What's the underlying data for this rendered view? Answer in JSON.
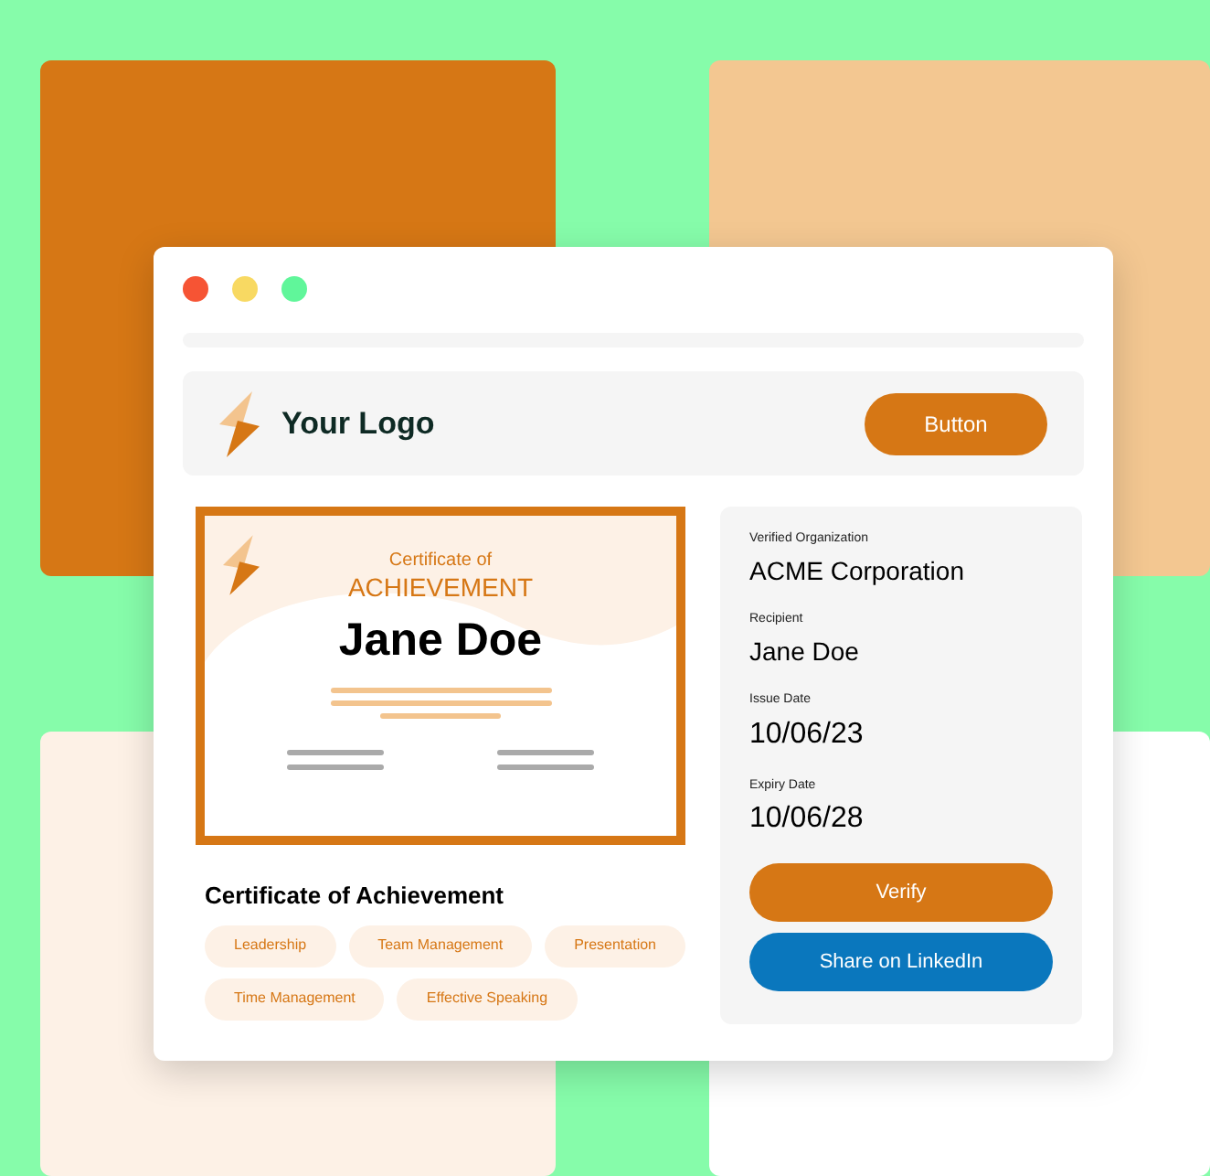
{
  "header": {
    "logo_text": "Your Logo",
    "button": "Button"
  },
  "certificate": {
    "subtitle": "Certificate of",
    "title": "ACHIEVEMENT",
    "recipient": "Jane Doe"
  },
  "course_title": "Certificate of Achievement",
  "skills": [
    "Leadership",
    "Team Management",
    "Presentation",
    "Time Management",
    "Effective Speaking"
  ],
  "details": [
    {
      "label": "Verified Organization",
      "value": "ACME Corporation"
    },
    {
      "label": "Recipient",
      "value": "Jane Doe"
    },
    {
      "label": "Issue Date",
      "value": "10/06/23"
    },
    {
      "label": "Expiry Date",
      "value": "10/06/28"
    }
  ],
  "actions": [
    {
      "label": "Verify",
      "kind": "primary"
    },
    {
      "label": "Share on LinkedIn",
      "kind": "linkedin"
    }
  ]
}
